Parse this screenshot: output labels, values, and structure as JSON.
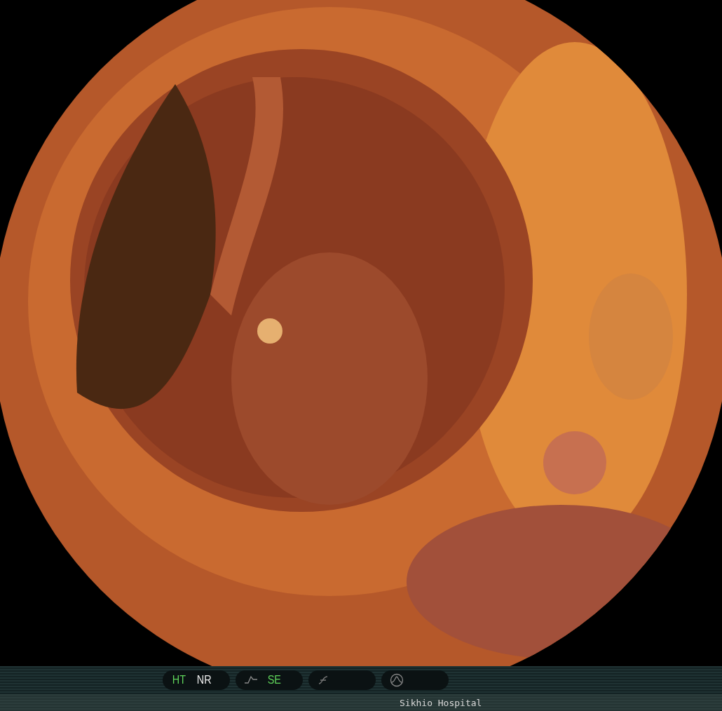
{
  "toolbar": {
    "groups": [
      {
        "kind": "plain",
        "labels": [
          {
            "text": "HT",
            "on": true
          },
          {
            "text": "NR",
            "on": false
          }
        ]
      },
      {
        "kind": "curve",
        "labels": [
          {
            "text": "SE",
            "on": true
          }
        ]
      },
      {
        "kind": "slash"
      },
      {
        "kind": "wave"
      }
    ]
  },
  "status_bar": {
    "text": "Sikhio Hospital"
  }
}
